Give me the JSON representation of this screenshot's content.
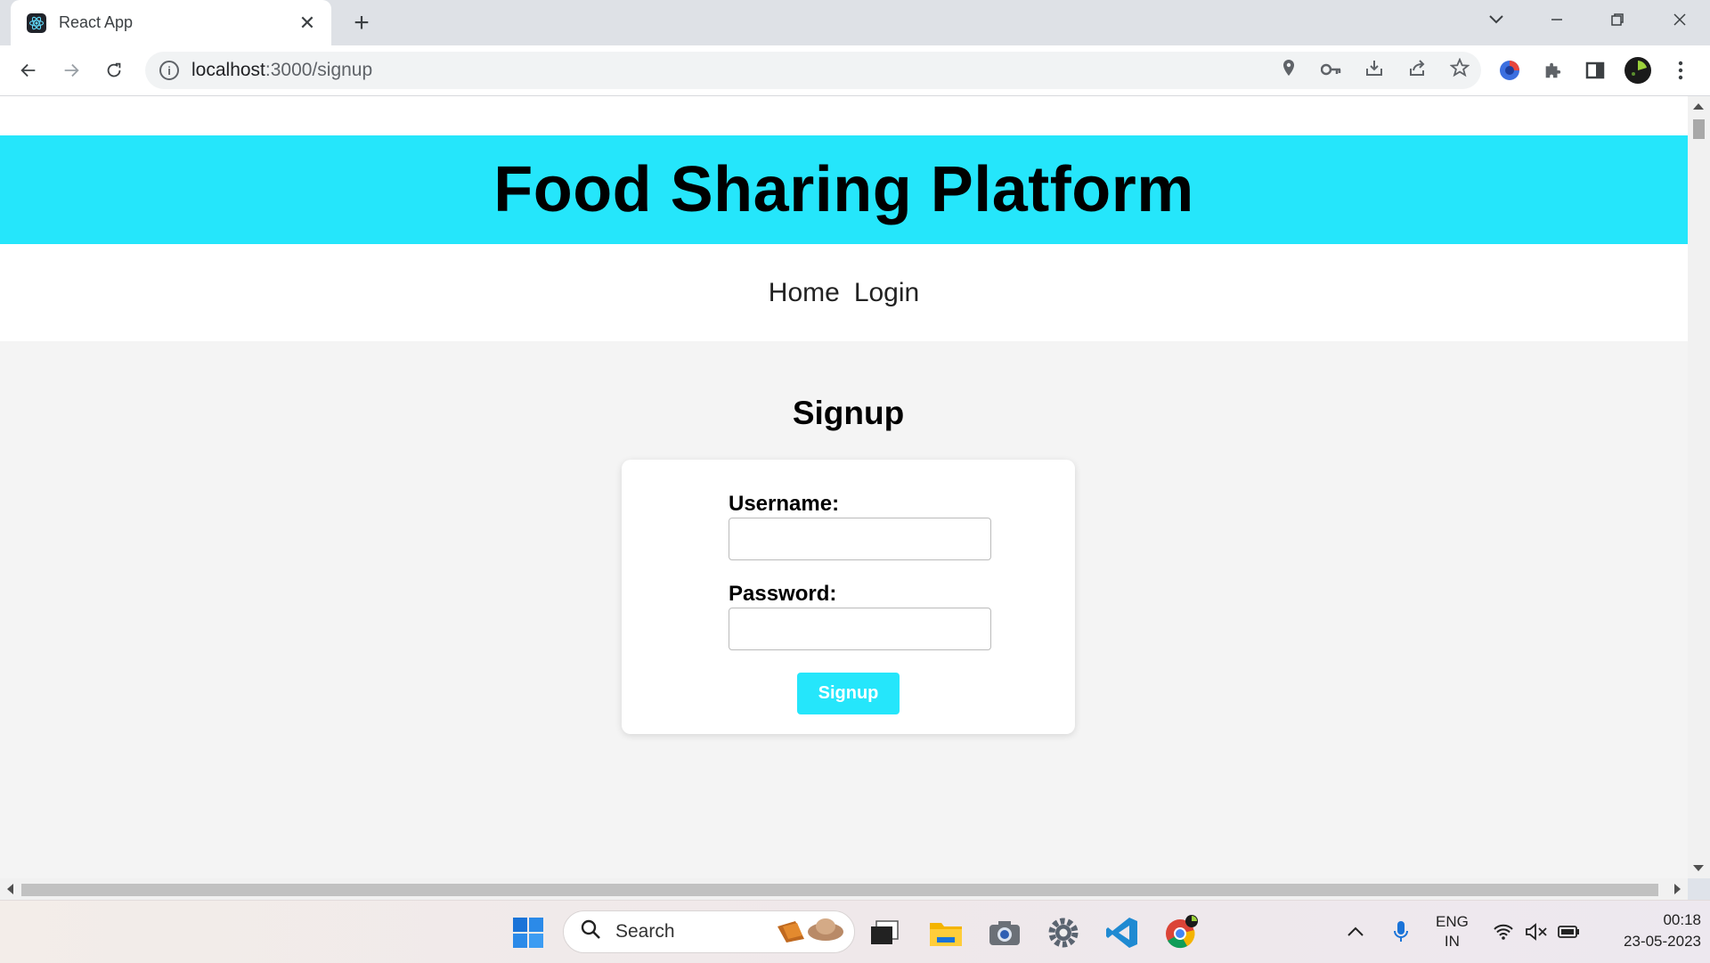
{
  "browser": {
    "tab_title": "React App",
    "url_host": "localhost",
    "url_path": ":3000/signup",
    "new_tab_symbol": "+",
    "close_symbol": "✕"
  },
  "page": {
    "header_title": "Food Sharing Platform",
    "nav": [
      {
        "label": "Home"
      },
      {
        "label": "Login"
      }
    ],
    "form_title": "Signup",
    "username_label": "Username:",
    "password_label": "Password:",
    "submit_label": "Signup",
    "accent_color": "#25e6fb"
  },
  "taskbar": {
    "search_placeholder": "Search",
    "lang_line1": "ENG",
    "lang_line2": "IN",
    "time": "00:18",
    "date": "23-05-2023"
  }
}
